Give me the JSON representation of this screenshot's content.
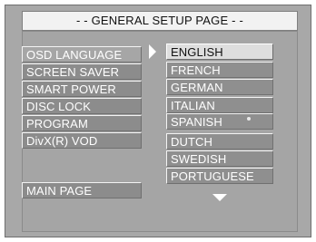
{
  "title": "- - GENERAL SETUP PAGE - -",
  "left_menu": {
    "items": [
      "OSD LANGUAGE",
      "SCREEN SAVER",
      "SMART POWER",
      "DISC LOCK",
      "PROGRAM",
      "DivX(R) VOD"
    ],
    "main_page": "MAIN PAGE"
  },
  "language_options": [
    "ENGLISH",
    "FRENCH",
    "GERMAN",
    "ITALIAN",
    "SPANISH",
    "DUTCH",
    "SWEDISH",
    "PORTUGUESE"
  ],
  "icons": {
    "right_indicator": "triangle-right-icon",
    "down_indicator": "triangle-down-icon"
  },
  "colors": {
    "background": "#a8a8a8",
    "title_bar": "#f2f2f2",
    "selected_option": "#dedede",
    "menu_item": "#8c8c8c"
  }
}
